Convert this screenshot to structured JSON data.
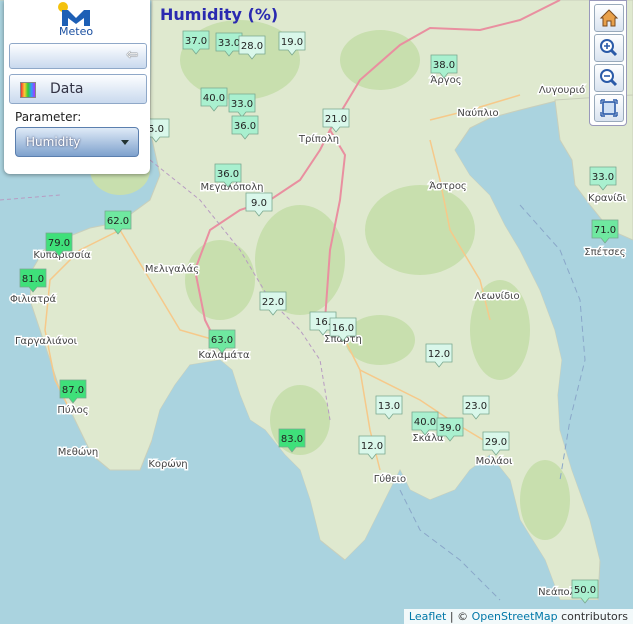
{
  "header": {
    "title": "Humidity (%)"
  },
  "logo": {
    "text": "Meteo"
  },
  "panel": {
    "data_label": "Data",
    "parameter_label": "Parameter:",
    "parameter_value": "Humidity"
  },
  "attribution": {
    "leaflet": "Leaflet",
    "separator": " | © ",
    "osm": "OpenStreetMap",
    "suffix": " contributors"
  },
  "places": [
    {
      "id": "argos",
      "name": "Άργος"
    },
    {
      "id": "nafplio",
      "name": "Ναύπλιο"
    },
    {
      "id": "lygourio",
      "name": "Λυγουριό"
    },
    {
      "id": "tripoli",
      "name": "Τρίπολη"
    },
    {
      "id": "megalopoli",
      "name": "Μεγαλόπολη"
    },
    {
      "id": "astros",
      "name": "Άστρος"
    },
    {
      "id": "kranidi",
      "name": "Κρανίδι"
    },
    {
      "id": "spetses",
      "name": "Σπέτσες"
    },
    {
      "id": "kyparissia",
      "name": "Κυπαρισσία"
    },
    {
      "id": "meligalas",
      "name": "Μελιγαλάς"
    },
    {
      "id": "filiatra",
      "name": "Φιλιατρά"
    },
    {
      "id": "leonidio",
      "name": "Λεωνίδιο"
    },
    {
      "id": "gargalianoi",
      "name": "Γαργαλιάνοι"
    },
    {
      "id": "kalamata",
      "name": "Καλαμάτα"
    },
    {
      "id": "sparti",
      "name": "Σπάρτη"
    },
    {
      "id": "pylos",
      "name": "Πύλος"
    },
    {
      "id": "skala",
      "name": "Σκάλα"
    },
    {
      "id": "methoni",
      "name": "Μεθώνη"
    },
    {
      "id": "koroni",
      "name": "Κορώνη"
    },
    {
      "id": "molaoi",
      "name": "Μολάοι"
    },
    {
      "id": "gytheio",
      "name": "Γύθειο"
    },
    {
      "id": "neapoli",
      "name": "Νεάπολη"
    }
  ],
  "stations": [
    {
      "id": "st-1",
      "value": "37.0"
    },
    {
      "id": "st-2",
      "value": "33.0"
    },
    {
      "id": "st-3",
      "value": "28.0"
    },
    {
      "id": "st-4",
      "value": "19.0"
    },
    {
      "id": "st-5",
      "value": "38.0"
    },
    {
      "id": "st-6",
      "value": "40.0"
    },
    {
      "id": "st-7",
      "value": "33.0"
    },
    {
      "id": "st-8",
      "value": "36.0"
    },
    {
      "id": "st-9",
      "value": "21.0"
    },
    {
      "id": "st-10",
      "value": "5.0"
    },
    {
      "id": "st-11",
      "value": "36.0"
    },
    {
      "id": "st-12",
      "value": "9.0"
    },
    {
      "id": "st-13",
      "value": "33.0"
    },
    {
      "id": "st-14",
      "value": "62.0"
    },
    {
      "id": "st-15",
      "value": "79.0"
    },
    {
      "id": "st-16",
      "value": "71.0"
    },
    {
      "id": "st-17",
      "value": "81.0"
    },
    {
      "id": "st-18",
      "value": "22.0"
    },
    {
      "id": "st-19",
      "value": "16."
    },
    {
      "id": "st-20",
      "value": "16.0"
    },
    {
      "id": "st-21",
      "value": "63.0"
    },
    {
      "id": "st-22",
      "value": "12.0"
    },
    {
      "id": "st-23",
      "value": "87.0"
    },
    {
      "id": "st-24",
      "value": "13.0"
    },
    {
      "id": "st-25",
      "value": "23.0"
    },
    {
      "id": "st-26",
      "value": "40.0"
    },
    {
      "id": "st-27",
      "value": "39.0"
    },
    {
      "id": "st-28",
      "value": "83.0"
    },
    {
      "id": "st-29",
      "value": "12.0"
    },
    {
      "id": "st-30",
      "value": "29.0"
    },
    {
      "id": "st-31",
      "value": "50.0"
    }
  ]
}
